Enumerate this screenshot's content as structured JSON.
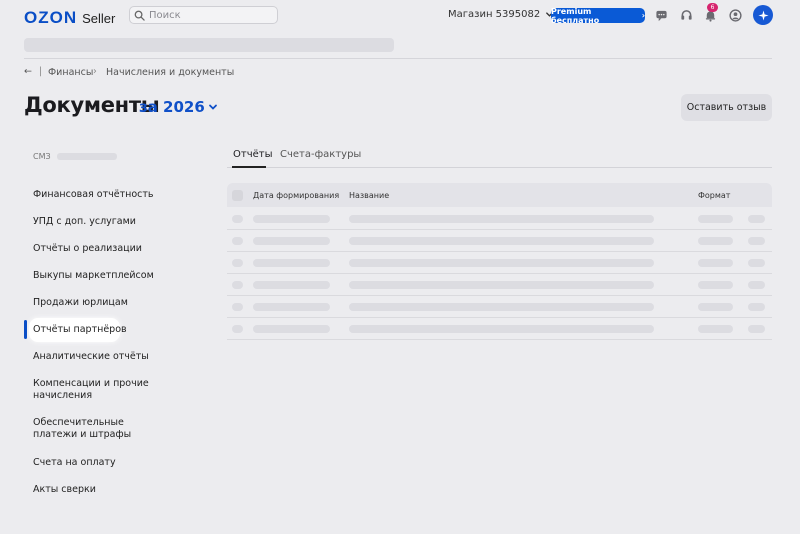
{
  "header": {
    "logo_text": "OZON",
    "logo_sub": "Seller",
    "search_placeholder": "Поиск",
    "store_label": "Магазин 5395082",
    "premium_label": "Premium бесплатно",
    "notifications_count": "6"
  },
  "breadcrumb": [
    "Финансы",
    "Начисления и документы"
  ],
  "page": {
    "title": "Документы",
    "year_label": "за 2026",
    "feedback_button": "Оставить отзыв"
  },
  "sidebar": {
    "caption": "СМЗ",
    "items": [
      {
        "label": "Финансовая отчётность"
      },
      {
        "label": "УПД с доп. услугами"
      },
      {
        "label": "Отчёты о реализации"
      },
      {
        "label": "Выкупы маркетплейсом"
      },
      {
        "label": "Продажи юрлицам"
      },
      {
        "label": "Отчёты партнёров",
        "active": true
      },
      {
        "label": "Аналитические отчёты"
      },
      {
        "label": "Компенсации и прочие начисления"
      },
      {
        "label": "Обеспечительные платежи и штрафы"
      },
      {
        "label": "Счета на оплату"
      },
      {
        "label": "Акты сверки"
      }
    ]
  },
  "tabs": [
    {
      "label": "Отчёты",
      "active": true
    },
    {
      "label": "Счета-фактуры",
      "active": false
    }
  ],
  "table": {
    "columns": [
      "Дата формирования",
      "Название",
      "Формат"
    ],
    "loading_rows": 6
  },
  "colors": {
    "brand": "#0a4ec6",
    "premium": "#0a5ad6",
    "badge": "#d6246e",
    "background": "#ececef"
  }
}
